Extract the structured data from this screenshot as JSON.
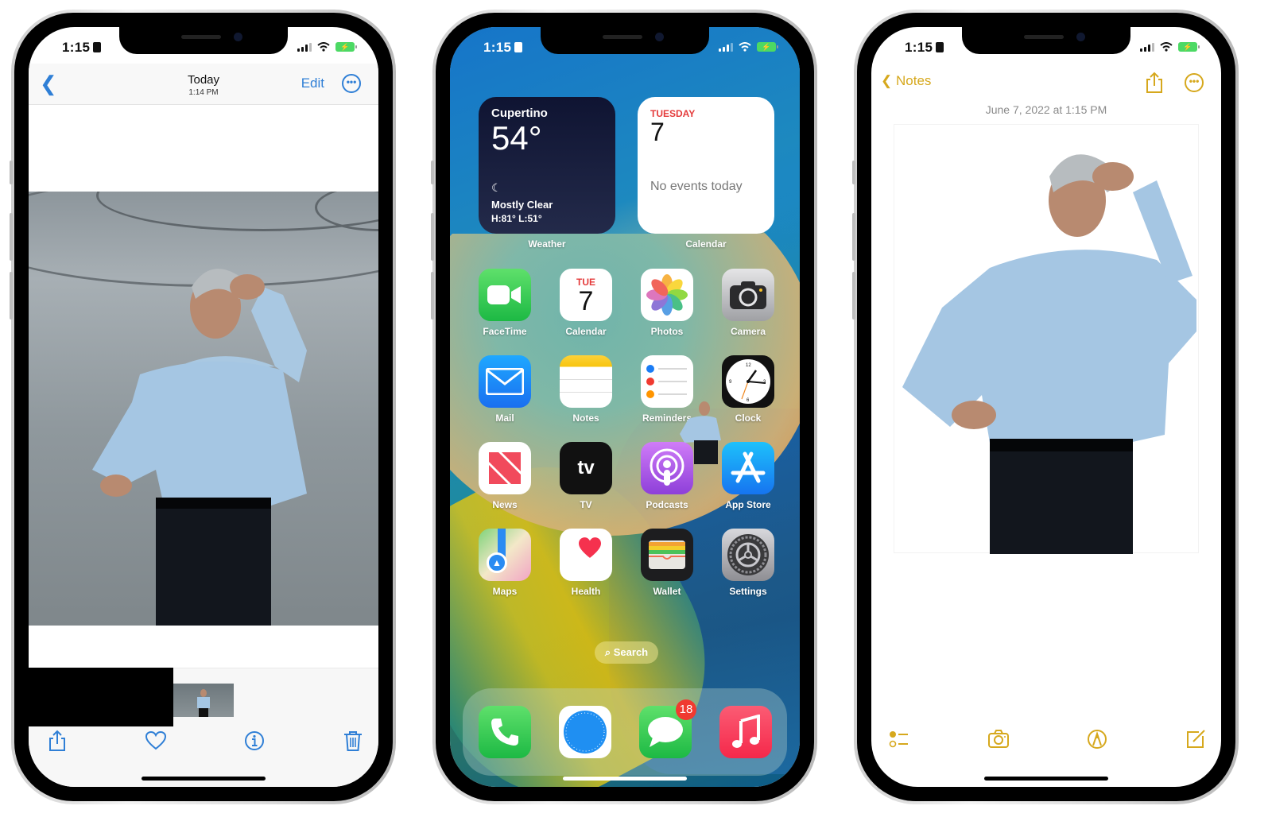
{
  "status_bar": {
    "time": "1:15",
    "battery_state": "charging"
  },
  "photos_screen": {
    "nav": {
      "back_icon": "chevron-left-icon",
      "title": "Today",
      "subtitle": "1:14 PM",
      "edit_label": "Edit",
      "more_icon": "ellipsis-circle-icon"
    },
    "toolbar": {
      "icons": [
        "share-icon",
        "heart-icon",
        "info-icon",
        "trash-icon"
      ]
    },
    "accent_color": "#2f7fd6"
  },
  "home_screen": {
    "widgets": {
      "weather": {
        "city": "Cupertino",
        "temperature": "54°",
        "condition": "Mostly Clear",
        "high_low": "H:81° L:51°",
        "label": "Weather"
      },
      "calendar": {
        "day": "TUESDAY",
        "date": "7",
        "events": "No events today",
        "label": "Calendar"
      }
    },
    "apps": [
      {
        "label": "FaceTime"
      },
      {
        "label": "Calendar",
        "day": "TUE",
        "date": "7"
      },
      {
        "label": "Photos"
      },
      {
        "label": "Camera"
      },
      {
        "label": "Mail"
      },
      {
        "label": "Notes"
      },
      {
        "label": "Reminders"
      },
      {
        "label": "Clock"
      },
      {
        "label": "News"
      },
      {
        "label": "TV",
        "glyph": "tv"
      },
      {
        "label": "Podcasts"
      },
      {
        "label": "App Store"
      },
      {
        "label": "Maps"
      },
      {
        "label": "Health"
      },
      {
        "label": "Wallet"
      },
      {
        "label": "Settings"
      }
    ],
    "search_label": "Search",
    "dock": [
      {
        "name": "Phone"
      },
      {
        "name": "Safari"
      },
      {
        "name": "Messages",
        "badge": "18"
      },
      {
        "name": "Music"
      }
    ]
  },
  "notes_screen": {
    "back_label": "Notes",
    "date": "June 7, 2022 at 1:15 PM",
    "toolbar": {
      "icons": [
        "checklist-icon",
        "camera-icon",
        "markup-icon",
        "compose-icon"
      ]
    },
    "accent_color": "#d6a81d"
  }
}
